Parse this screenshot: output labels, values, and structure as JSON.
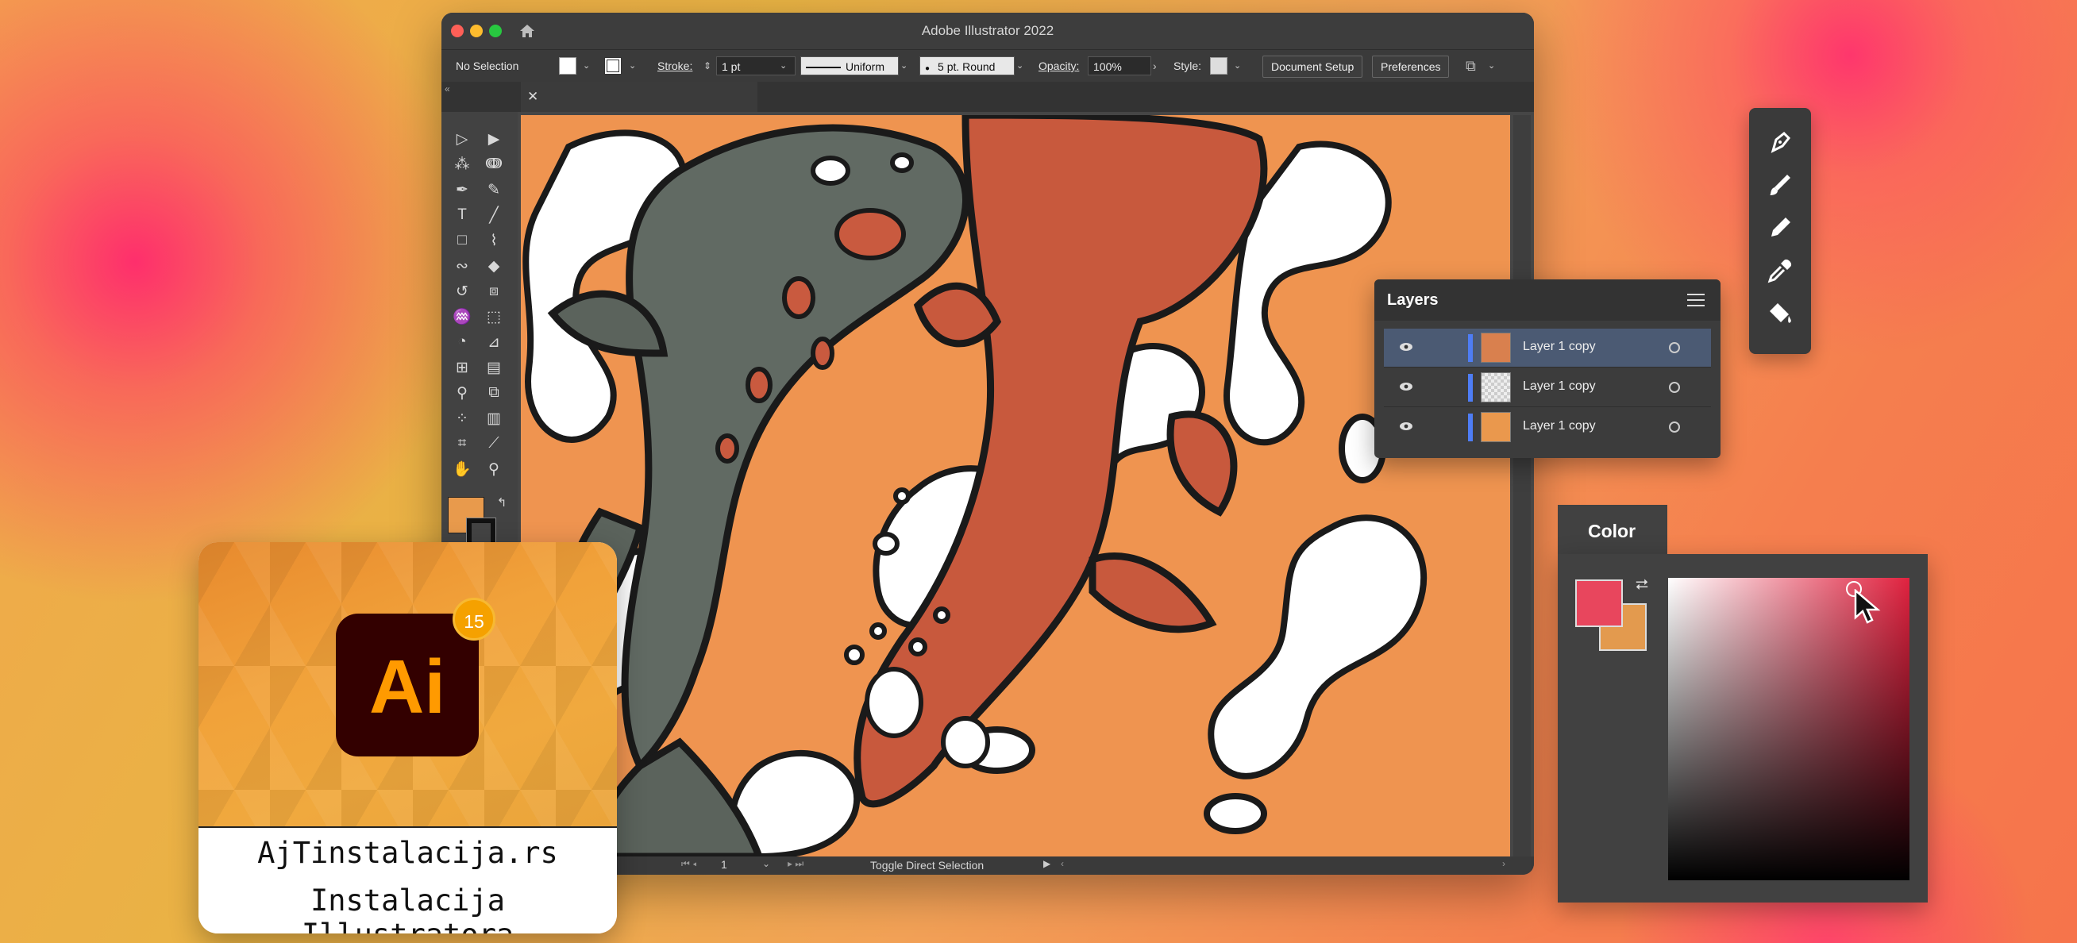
{
  "window": {
    "title": "Adobe Illustrator 2022"
  },
  "control_bar": {
    "selection": "No Selection",
    "stroke_label": "Stroke:",
    "stroke_weight": "1 pt",
    "profile": "Uniform",
    "brush": "5 pt. Round",
    "opacity_label": "Opacity:",
    "opacity_value": "100%",
    "style_label": "Style:",
    "document_setup": "Document Setup",
    "preferences": "Preferences"
  },
  "status_bar": {
    "artboard": "1",
    "status": "Toggle Direct Selection"
  },
  "layers": {
    "title": "Layers",
    "rows": [
      {
        "name": "Layer 1 copy",
        "selected": true
      },
      {
        "name": "Layer 1 copy",
        "selected": false
      },
      {
        "name": "Layer 1 copy",
        "selected": false
      }
    ]
  },
  "color_panel": {
    "title": "Color",
    "fill_color": "#e8465d",
    "stroke_color": "#e39a4e"
  },
  "app_card": {
    "logo_text": "Ai",
    "badge": "15",
    "caption_line1": "AjTinstalacija.rs",
    "caption_line2": "Instalacija Illustratora"
  },
  "colors": {
    "accent": "#ff9a00",
    "canvas": "#ef9450",
    "layer_color": "#4e7df5"
  }
}
